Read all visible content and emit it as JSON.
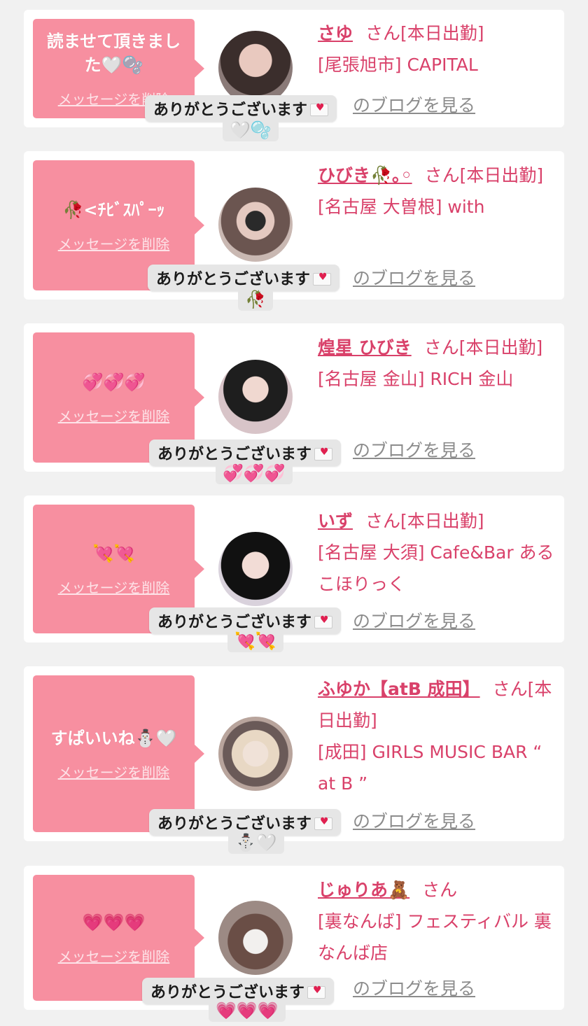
{
  "reply_text": "ありがとうございます",
  "blog_link_label": "のブログを見る",
  "delete_label": "メッセージを削除",
  "cards": [
    {
      "bubble_text": "読ませて頂きました🤍🫧",
      "name": "さゆ",
      "suffix": "さん[本日出勤]",
      "store": "[尾張旭市] CAPITAL",
      "reply_emoji": "🤍🫧"
    },
    {
      "bubble_text": "🥀<ﾁﾋﾞｽﾊﾟｰｯ",
      "name": "ひびき🥀｡◦",
      "suffix": "さん[本日出勤]",
      "store": "[名古屋 大曽根] with",
      "reply_emoji": "🥀"
    },
    {
      "bubble_text": "💞💞💞",
      "name": "煌星 ひびき",
      "suffix": "さん[本日出勤]",
      "store": "[名古屋 金山] RICH 金山",
      "reply_emoji": "💞💞💞"
    },
    {
      "bubble_text": "💘💘",
      "name": "いず",
      "suffix": "さん[本日出勤]",
      "store": "[名古屋 大須] Cafe&Bar あるこほりっく",
      "reply_emoji": "💘💘"
    },
    {
      "bubble_text": "すぱいいね⛄️🤍",
      "name": "ふゆか【atB 成田】",
      "suffix": "さん[本日出勤]",
      "store": "[成田] GIRLS MUSIC BAR “ at B ”",
      "reply_emoji": "⛄️🤍"
    },
    {
      "bubble_text": "💗💗💗",
      "name": "じゅりあ🧸",
      "suffix": "さん",
      "store": "[裏なんば] フェスティバル 裏なんば店",
      "reply_emoji": "💗💗💗"
    }
  ]
}
